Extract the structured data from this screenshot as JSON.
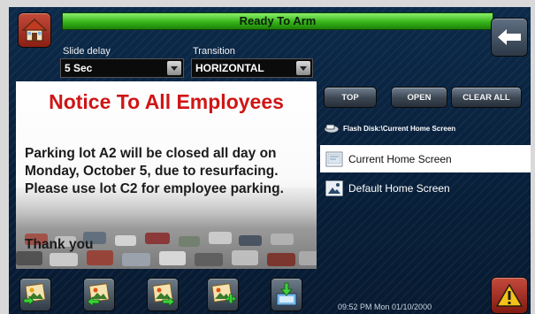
{
  "status": {
    "text": "Ready To Arm",
    "color": "#36b51a"
  },
  "controls": {
    "slide_delay_label": "Slide delay",
    "slide_delay_value": "5 Sec",
    "transition_label": "Transition",
    "transition_value": "HORIZONTAL"
  },
  "notice": {
    "title": "Notice To All Employees",
    "body": "Parking lot A2 will be closed all day on Monday, October 5, due to resurfacing. Please use lot C2 for employee parking.",
    "signoff": "Thank you",
    "title_color": "#d01515"
  },
  "file_panel": {
    "buttons": [
      "TOP",
      "OPEN",
      "CLEAR ALL"
    ],
    "path": "Flash Disk:\\Current Home Screen",
    "items": [
      {
        "label": "Current Home Screen",
        "selected": true,
        "icon": "screen-file-icon"
      },
      {
        "label": "Default Home Screen",
        "selected": false,
        "icon": "image-file-icon"
      }
    ]
  },
  "clock": {
    "text": "09:52 PM  Mon 01/10/2000"
  },
  "icons": {
    "home": "home-icon",
    "back": "back-arrow-icon",
    "alarm": "warning-icon",
    "toolbar": [
      "add-slide-icon",
      "previous-slide-icon",
      "next-slide-icon",
      "add-image-icon",
      "download-icon"
    ]
  }
}
